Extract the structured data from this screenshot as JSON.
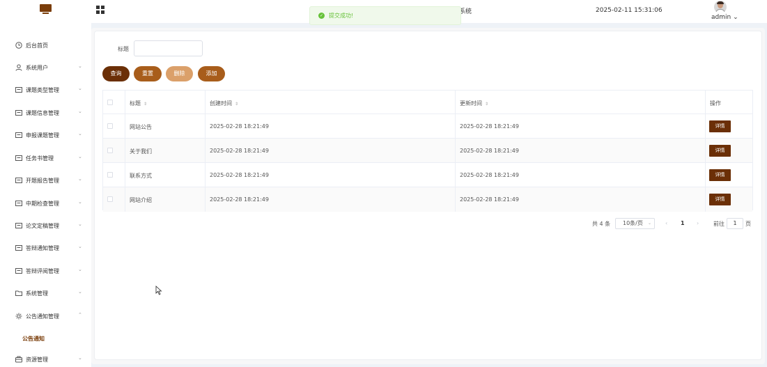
{
  "header": {
    "system_title_partial": "系统",
    "datetime": "2025-02-11 15:31:06",
    "user": "admin",
    "user_caret": "⌄"
  },
  "toast": {
    "icon": "check-circle-icon",
    "message": "提交成功!"
  },
  "sidebar": {
    "items": [
      {
        "label": "后台首页",
        "icon": "clock-icon"
      },
      {
        "label": "系统用户",
        "icon": "user-icon"
      },
      {
        "label": "课题类型管理",
        "icon": "folder-icon"
      },
      {
        "label": "课题信息管理",
        "icon": "folder-icon"
      },
      {
        "label": "申报课题管理",
        "icon": "folder-icon"
      },
      {
        "label": "任务书管理",
        "icon": "folder-icon"
      },
      {
        "label": "开题报告管理",
        "icon": "folder-icon"
      },
      {
        "label": "中期检查管理",
        "icon": "folder-icon"
      },
      {
        "label": "论文定稿管理",
        "icon": "folder-icon"
      },
      {
        "label": "答辩通知管理",
        "icon": "folder-icon"
      },
      {
        "label": "答辩评阅管理",
        "icon": "folder-icon"
      },
      {
        "label": "系统管理",
        "icon": "folder-icon"
      },
      {
        "label": "公告通知管理",
        "icon": "settings-icon"
      },
      {
        "label": "资源管理",
        "icon": "box-icon"
      }
    ],
    "active_sub": "公告通知",
    "chevron_down": "⌄",
    "chevron_up": "⌃"
  },
  "search": {
    "title_label": "标题",
    "title_value": ""
  },
  "buttons": {
    "query": "查询",
    "reset": "重置",
    "delete": "删除",
    "add": "添加"
  },
  "table": {
    "columns": [
      "标题",
      "创建时间",
      "更新时间",
      "操作"
    ],
    "sort_glyph": "⇕",
    "rows": [
      {
        "title": "网站公告",
        "created": "2025-02-28 18:21:49",
        "updated": "2025-02-28 18:21:49",
        "action": "详情"
      },
      {
        "title": "关于我们",
        "created": "2025-02-28 18:21:49",
        "updated": "2025-02-28 18:21:49",
        "action": "详情"
      },
      {
        "title": "联系方式",
        "created": "2025-02-28 18:21:49",
        "updated": "2025-02-28 18:21:49",
        "action": "详情"
      },
      {
        "title": "网站介绍",
        "created": "2025-02-28 18:21:49",
        "updated": "2025-02-28 18:21:49",
        "action": "详情"
      }
    ]
  },
  "pagination": {
    "total": "共 4 条",
    "page_size": "10条/页",
    "prev": "‹",
    "current": "1",
    "next": "›",
    "goto_label": "前往",
    "goto_value": "1",
    "page_suffix": "页",
    "dropdown_caret": "⌄"
  },
  "colors": {
    "brand_dark": "#6b2f07",
    "brand_mid": "#a85d1b",
    "brand_light": "#dba06a",
    "success": "#67c23a"
  }
}
